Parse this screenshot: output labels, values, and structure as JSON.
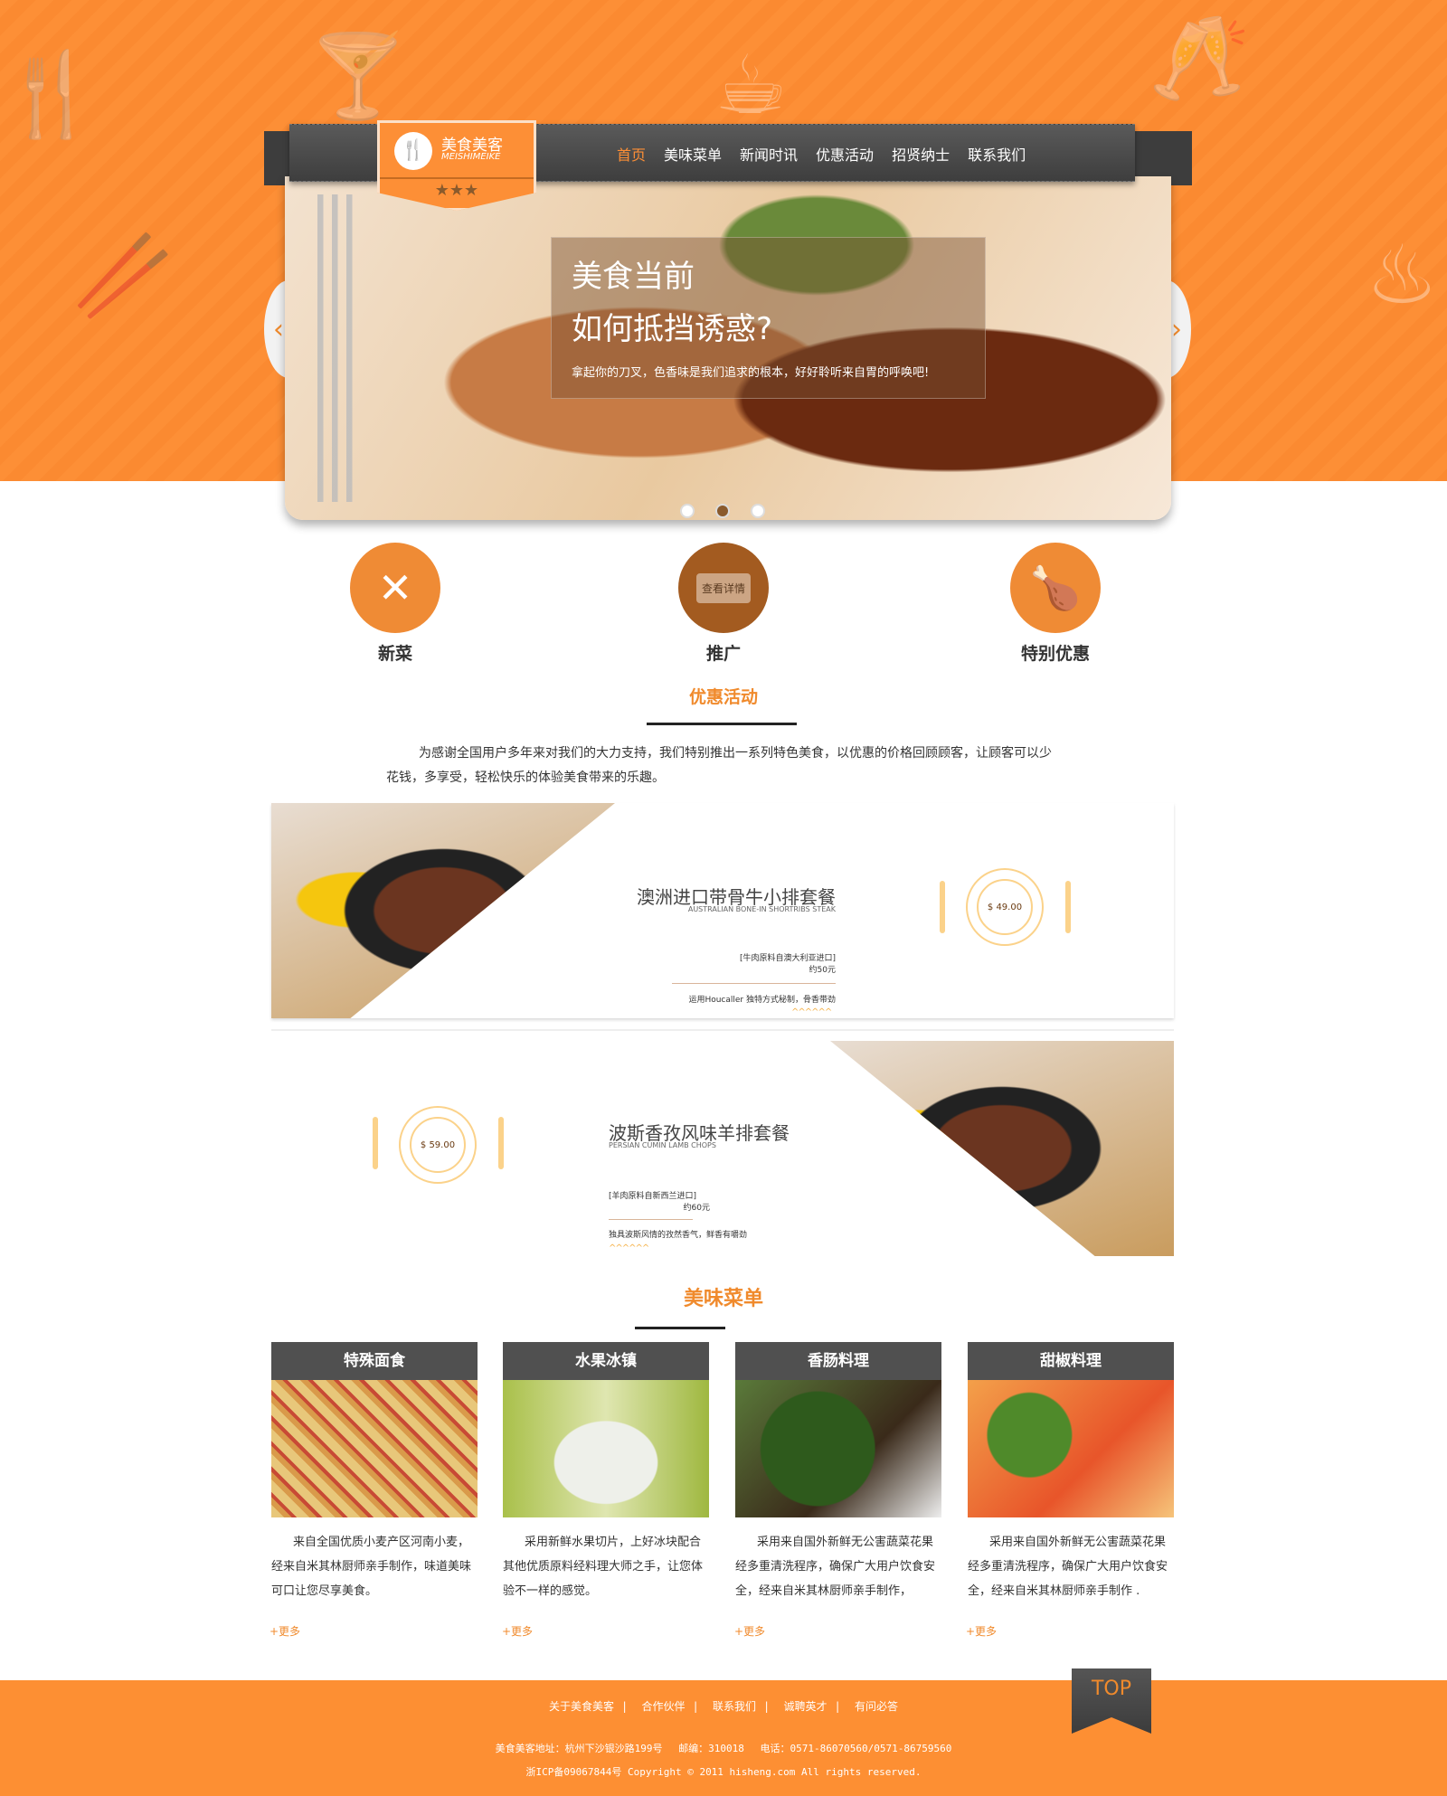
{
  "logo": {
    "cn": "美食美客",
    "en": "MEISHIMEIKE",
    "stars": "★★★"
  },
  "nav": [
    "首页",
    "美味菜单",
    "新闻时讯",
    "优惠活动",
    "招贤纳士",
    "联系我们"
  ],
  "slider": {
    "title1": "美食当前",
    "title2": "如何抵挡诱惑?",
    "text": "拿起你的刀叉，色香味是我们追求的根本，好好聆听来自胃的呼唤吧!",
    "prev": "‹",
    "next": "›",
    "slides": 3,
    "active": 2
  },
  "features": [
    {
      "label": "新菜",
      "icon": "spoon-fork-icon"
    },
    {
      "label": "推广",
      "icon": "wine-glasses-icon",
      "overlay": "查看详情"
    },
    {
      "label": "特别优惠",
      "icon": "roast-chicken-icon"
    }
  ],
  "promo": {
    "title": "优惠活动",
    "intro": "为感谢全国用户多年来对我们的大力支持，我们特别推出一系列特色美食，以优惠的价格回顾顾客，让顾客可以少花钱，多享受，轻松快乐的体验美食带来的乐趣。",
    "items": [
      {
        "name": "澳洲进口带骨牛小排套餐",
        "en": "AUSTRALIAN BONE-IN SHORTRIBS STEAK",
        "origin": "[牛肉原料自澳大利亚进口]",
        "weight": "约50元",
        "desc": "运用Houcaller 独特方式秘制，骨香带劲",
        "price": "$ 49.00"
      },
      {
        "name": "波斯香孜风味羊排套餐",
        "en": "PERSIAN CUMIN LAMB CHOPS",
        "origin": "[羊肉原料自新西兰进口]",
        "weight": "约60元",
        "desc": "独具波斯风情的孜然香气，鲜香有嚼劲",
        "price": "$ 59.00"
      }
    ]
  },
  "menu": {
    "title": "美味菜单",
    "more": "+更多",
    "items": [
      {
        "name": "特殊面食",
        "text": "来自全国优质小麦产区河南小麦，经来自米其林厨师亲手制作，味道美味可口让您尽享美食。"
      },
      {
        "name": "水果冰镇",
        "text": "采用新鲜水果切片，上好冰块配合其他优质原料经料理大师之手，让您体验不一样的感觉。"
      },
      {
        "name": "香肠料理",
        "text": "采用来自国外新鲜无公害蔬菜花果经多重清洗程序，确保广大用户饮食安全，经来自米其林厨师亲手制作，"
      },
      {
        "name": "甜椒料理",
        "text": "采用来自国外新鲜无公害蔬菜花果经多重清洗程序，确保广大用户饮食安全，经来自米其林厨师亲手制作 ."
      }
    ]
  },
  "footer": {
    "links": [
      "关于美食美客",
      "合作伙伴",
      "联系我们",
      "诚聘英才",
      "有问必答"
    ],
    "separator": "|",
    "address": "美食美客地址：杭州下沙银沙路199号　 邮编：310018　 电话：0571-86070560/0571-86759560",
    "copyright": "浙ICP备09067844号 Copyright © 2011 hisheng.com All rights reserved."
  },
  "top_button": "TOP",
  "colors": {
    "accent": "#fd8f36",
    "dark": "#505050"
  }
}
